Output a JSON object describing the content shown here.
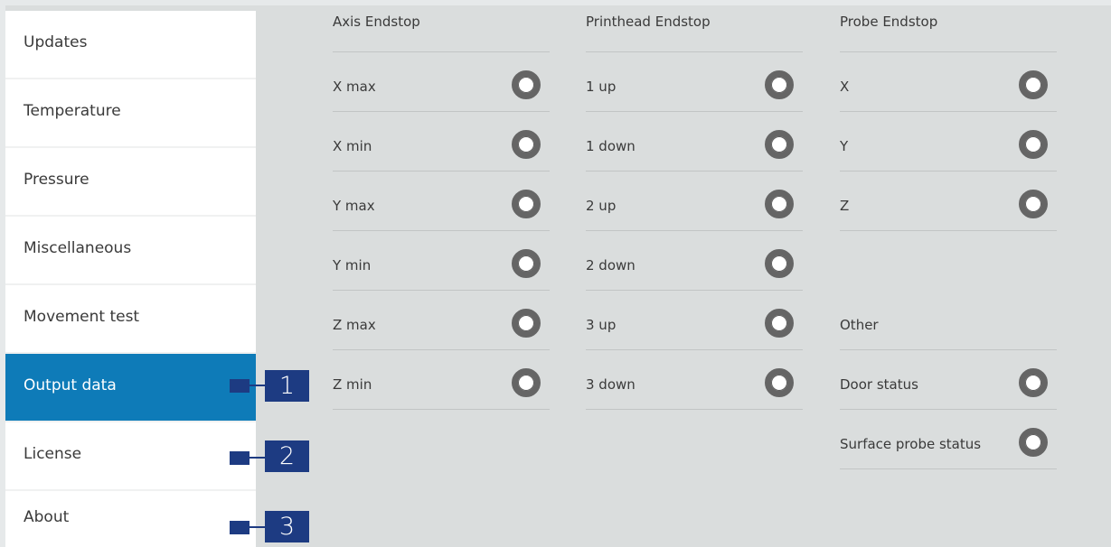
{
  "sidebar": {
    "items": [
      {
        "label": "Updates"
      },
      {
        "label": "Temperature"
      },
      {
        "label": "Pressure"
      },
      {
        "label": "Miscellaneous"
      },
      {
        "label": "Movement test"
      },
      {
        "label": "Output data",
        "active": true
      },
      {
        "label": "License"
      },
      {
        "label": "About"
      }
    ]
  },
  "callouts": [
    "1",
    "2",
    "3"
  ],
  "columns": {
    "axis": {
      "title": "Axis Endstop",
      "rows": [
        "X max",
        "X min",
        "Y max",
        "Y min",
        "Z max",
        "Z min"
      ]
    },
    "printhead": {
      "title": "Printhead Endstop",
      "rows": [
        "1 up",
        "1 down",
        "2 up",
        "2 down",
        "3 up",
        "3 down"
      ]
    },
    "probe": {
      "title": "Probe Endstop",
      "rows": [
        "X",
        "Y",
        "Z"
      ]
    },
    "other": {
      "title": "Other",
      "rows": [
        "Door status",
        "Surface probe status"
      ]
    }
  },
  "colors": {
    "active_nav": "#0e7bb8",
    "callout": "#1d3b82",
    "indicator_ring": "#656565",
    "background": "#dadddd"
  },
  "icons": {
    "indicator": "status-indicator-icon"
  }
}
